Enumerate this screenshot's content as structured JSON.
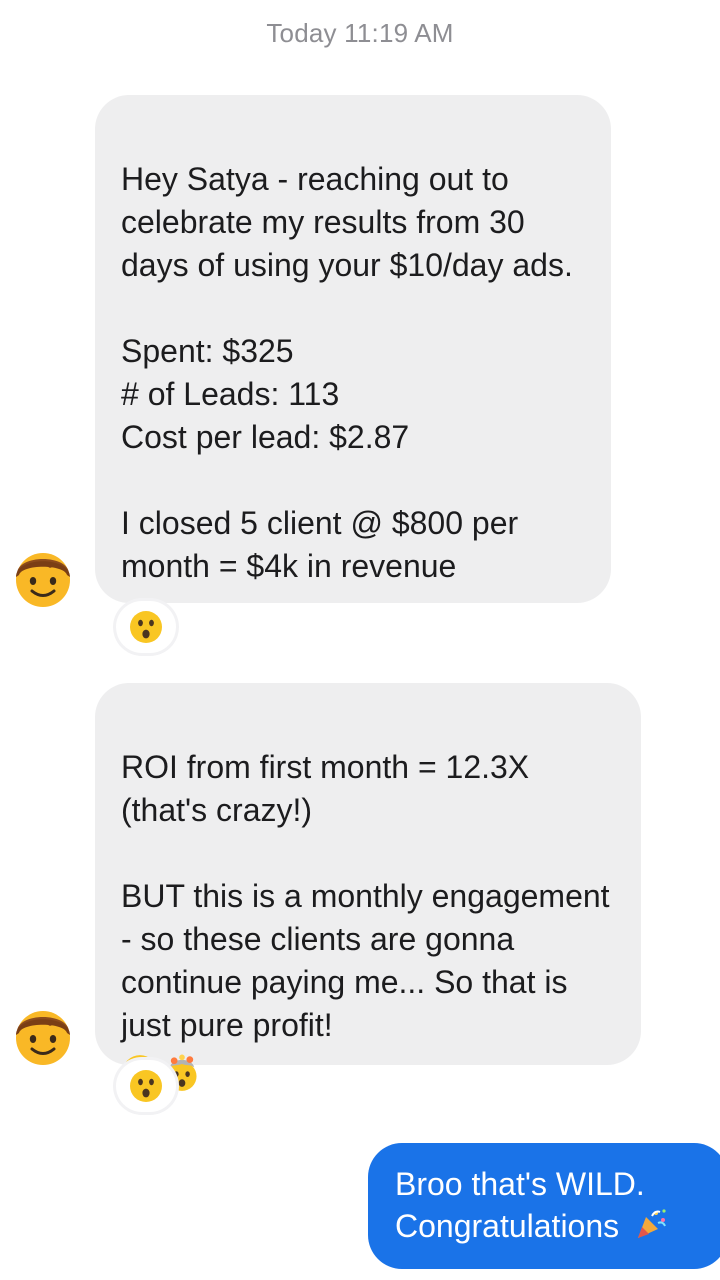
{
  "conversation": {
    "timestamp": "Today 11:19 AM",
    "messages": [
      {
        "direction": "incoming",
        "text": "Hey Satya - reaching out to celebrate my results from 30 days of using your $10/day ads.\n\nSpent: $325\n# of Leads: 113\nCost per lead: $2.87\n\nI closed 5 client @ $800 per month = $4k in revenue",
        "reaction": "astonished-face-emoji"
      },
      {
        "direction": "incoming",
        "text": "ROI from first month = 12.3X (that's crazy!)\n\nBUT this is a monthly engagement - so these clients are gonna continue paying me... So that is just pure profit!",
        "trailing_emojis": [
          "astonished-face-emoji",
          "exploding-head-emoji"
        ],
        "reaction": "astonished-face-emoji"
      },
      {
        "direction": "outgoing",
        "lines": [
          "Broo that's WILD.",
          "Congratulations"
        ],
        "trailing_emoji": "party-popper-emoji"
      }
    ],
    "sender_avatar": "boy-emoji-avatar"
  },
  "colors": {
    "incoming_bubble": "#eeeeef",
    "outgoing_bubble": "#1a73e8",
    "timestamp_text": "#8e8e93"
  }
}
